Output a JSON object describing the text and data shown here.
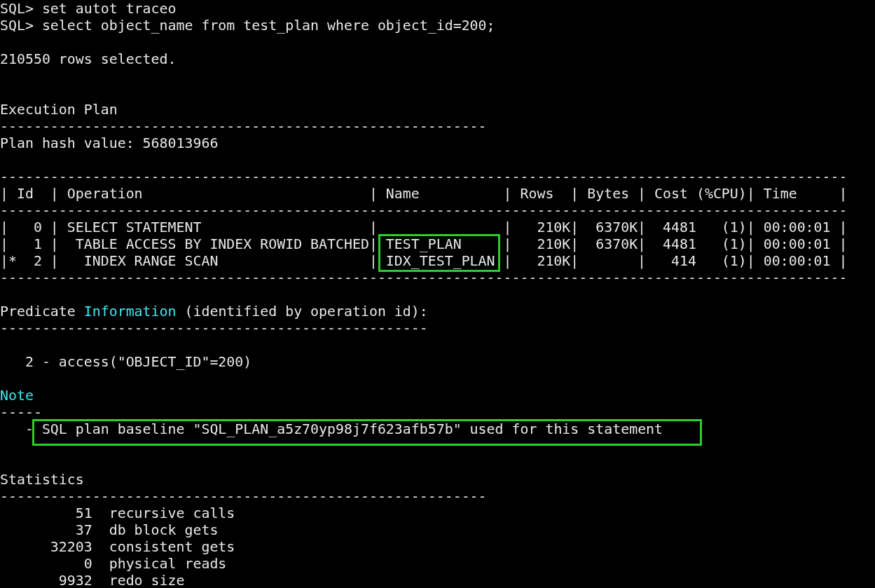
{
  "terminal": {
    "lines": [
      {
        "kind": "text",
        "text": "SQL> set autot traceo"
      },
      {
        "kind": "text",
        "text": "SQL> select object_name from test_plan where object_id=200;"
      },
      {
        "kind": "blank"
      },
      {
        "kind": "text",
        "text": "210550 rows selected."
      },
      {
        "kind": "blank"
      },
      {
        "kind": "blank"
      },
      {
        "kind": "text",
        "text": "Execution Plan"
      },
      {
        "kind": "text",
        "text": "----------------------------------------------------------"
      },
      {
        "kind": "text",
        "text": "Plan hash value: 568013966"
      },
      {
        "kind": "blank"
      },
      {
        "kind": "text",
        "text": "-----------------------------------------------------------------------------------------------------"
      },
      {
        "kind": "text",
        "text": "| Id  | Operation                           | Name          | Rows  | Bytes | Cost (%CPU)| Time     |"
      },
      {
        "kind": "text",
        "text": "-----------------------------------------------------------------------------------------------------"
      },
      {
        "kind": "text",
        "text": "|   0 | SELECT STATEMENT                    |               |   210K|  6370K|  4481   (1)| 00:00:01 |"
      },
      {
        "kind": "mixed",
        "segments": [
          {
            "kind": "plain",
            "text": "|   1 |  TABLE ACCESS BY INDEX ROWID BATCHED| "
          },
          {
            "kind": "boxed",
            "text": "TEST_PLAN    "
          },
          {
            "kind": "plain",
            "text": " |   210K|  6370K|  4481   (1)| 00:00:01 |"
          }
        ]
      },
      {
        "kind": "mixed",
        "segments": [
          {
            "kind": "plain",
            "text": "|*  2 |   INDEX RANGE SCAN                  | "
          },
          {
            "kind": "boxed",
            "text": "IDX_TEST_PLAN"
          },
          {
            "kind": "plain",
            "text": " |   210K|       |   414   (1)| 00:00:01 |"
          }
        ]
      },
      {
        "kind": "text",
        "text": "-----------------------------------------------------------------------------------------------------"
      },
      {
        "kind": "blank"
      },
      {
        "kind": "mixed",
        "segments": [
          {
            "kind": "plain",
            "text": "Predicate "
          },
          {
            "kind": "keyword",
            "text": "Information"
          },
          {
            "kind": "plain",
            "text": " (identified by operation id):"
          }
        ]
      },
      {
        "kind": "text",
        "text": "---------------------------------------------------"
      },
      {
        "kind": "blank"
      },
      {
        "kind": "text",
        "text": "   2 - access(\"OBJECT_ID\"=200)"
      },
      {
        "kind": "blank"
      },
      {
        "kind": "mixed",
        "segments": [
          {
            "kind": "keyword",
            "text": "Note"
          }
        ]
      },
      {
        "kind": "text",
        "text": "-----"
      },
      {
        "kind": "mixed",
        "segments": [
          {
            "kind": "plain",
            "text": "   - "
          },
          {
            "kind": "boxed",
            "text": "SQL plan baseline \"SQL_PLAN_a5z70yp98j7f623afb57b\" used for this statement"
          }
        ]
      },
      {
        "kind": "blank"
      },
      {
        "kind": "blank"
      },
      {
        "kind": "text",
        "text": "Statistics"
      },
      {
        "kind": "text",
        "text": "----------------------------------------------------------"
      },
      {
        "kind": "text",
        "text": "         51  recursive calls"
      },
      {
        "kind": "text",
        "text": "         37  db block gets"
      },
      {
        "kind": "text",
        "text": "      32203  consistent gets"
      },
      {
        "kind": "text",
        "text": "          0  physical reads"
      },
      {
        "kind": "text",
        "text": "       9932  redo size"
      }
    ]
  }
}
